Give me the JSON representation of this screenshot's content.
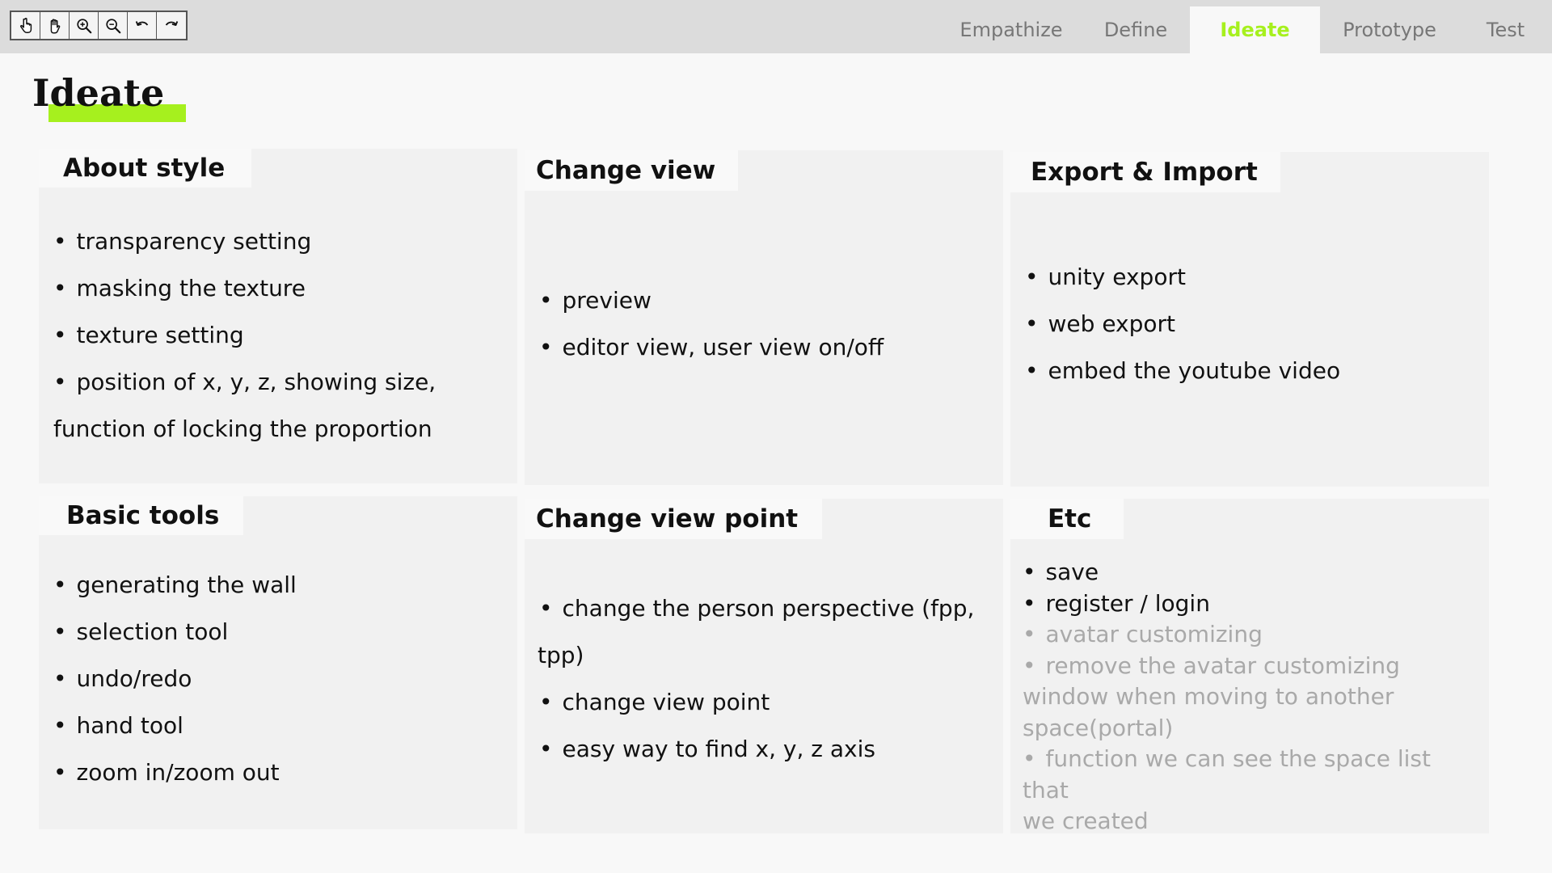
{
  "toolbar": {
    "tools": [
      {
        "name": "pointer-icon"
      },
      {
        "name": "hand-icon"
      },
      {
        "name": "zoom-in-icon"
      },
      {
        "name": "zoom-out-icon"
      },
      {
        "name": "undo-icon"
      },
      {
        "name": "redo-icon"
      }
    ]
  },
  "tabs": [
    {
      "label": "Empathize",
      "active": false
    },
    {
      "label": "Define",
      "active": false
    },
    {
      "label": "Ideate",
      "active": true
    },
    {
      "label": "Prototype",
      "active": false
    },
    {
      "label": "Test",
      "active": false
    }
  ],
  "colors": {
    "accent": "#a6f01e",
    "topbar": "#dcdcdc",
    "card": "#f1f1f1",
    "muted_text": "#a9a9a9"
  },
  "page": {
    "title": "Ideate"
  },
  "cards": [
    {
      "title": "About style",
      "items": [
        "transparency setting",
        "masking the texture",
        "texture setting",
        "position of x, y, z, showing size,",
        "function of locking the proportion"
      ]
    },
    {
      "title": "Change view",
      "items": [
        "preview",
        "editor view, user view on/off"
      ]
    },
    {
      "title": "Export & Import",
      "items": [
        "unity export",
        "web export",
        "embed the youtube video"
      ]
    },
    {
      "title": "Basic tools",
      "items": [
        "generating the wall",
        "selection tool",
        "undo/redo",
        "hand tool",
        "zoom in/zoom out"
      ]
    },
    {
      "title": "Change view point",
      "items": [
        "change the person perspective (fpp,",
        "tpp)",
        "change view point",
        "easy way to find x, y, z axis"
      ]
    },
    {
      "title": "Etc",
      "items": [
        "save",
        "register / login",
        "avatar customizing",
        "remove the avatar customizing",
        "window when moving to another",
        "space(portal)",
        "function we can see the space list that",
        "we created"
      ]
    }
  ]
}
